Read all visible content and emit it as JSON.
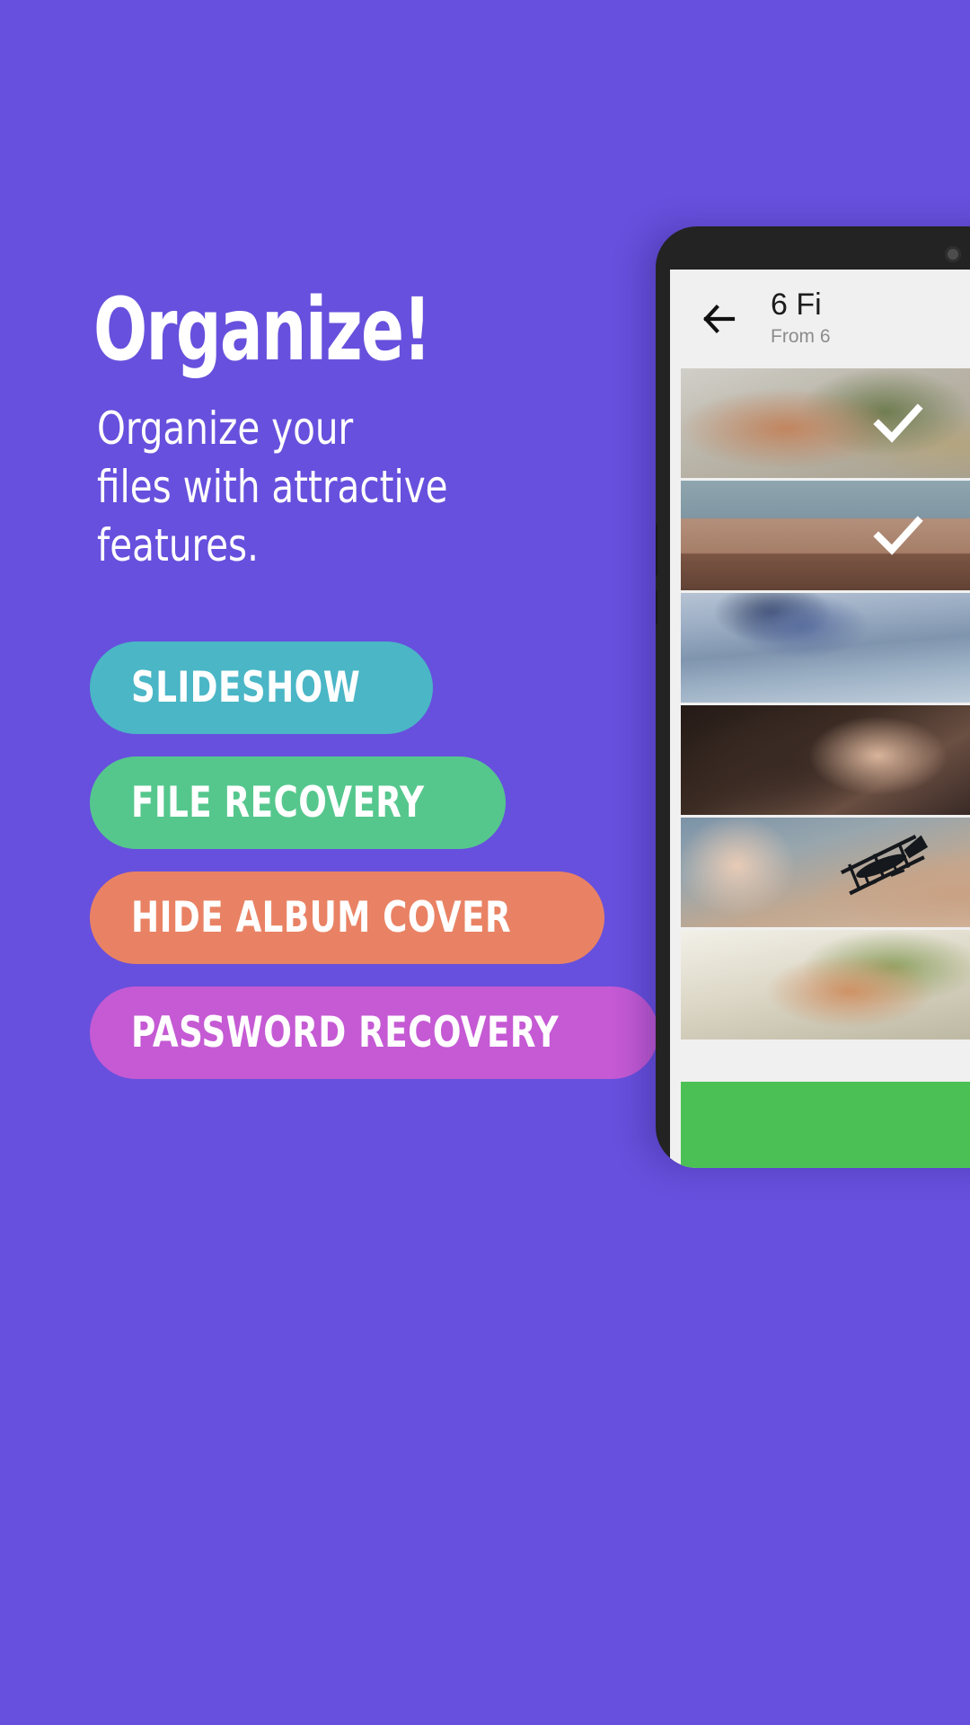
{
  "theme": {
    "background": "#6750dd",
    "text_on_background": "#ffffff"
  },
  "headline": "Organize!",
  "subtitle": {
    "line1": "Organize your",
    "line2": "files with attractive",
    "line3": "features."
  },
  "buttons": [
    {
      "label": "SLIDESHOW",
      "color": "#4ab6c6"
    },
    {
      "label": "FILE RECOVERY",
      "color": "#55c78d"
    },
    {
      "label": "HIDE ALBUM COVER",
      "color": "#e98264"
    },
    {
      "label": "PASSWORD RECOVERY",
      "color": "#c55ad4"
    }
  ],
  "phone": {
    "app_bar": {
      "back_icon": "arrow-left-icon",
      "title": "6 Fi",
      "subtitle": "From 6"
    },
    "thumbnails": [
      {
        "name": "leaf-photo",
        "art": "img-leaf",
        "selected": true
      },
      {
        "name": "house-photo",
        "art": "img-house",
        "selected": true
      },
      {
        "name": "water-photo",
        "art": "img-water",
        "selected": false
      },
      {
        "name": "portrait-photo",
        "art": "img-portrait",
        "selected": false
      },
      {
        "name": "plane-photo",
        "art": "img-plane",
        "selected": false
      },
      {
        "name": "leaf-photo-2",
        "art": "img-leaf2",
        "selected": false
      }
    ],
    "action_bar_color": "#4bc155",
    "bezel_color": "#232323",
    "screen_background": "#f0f0f0"
  }
}
